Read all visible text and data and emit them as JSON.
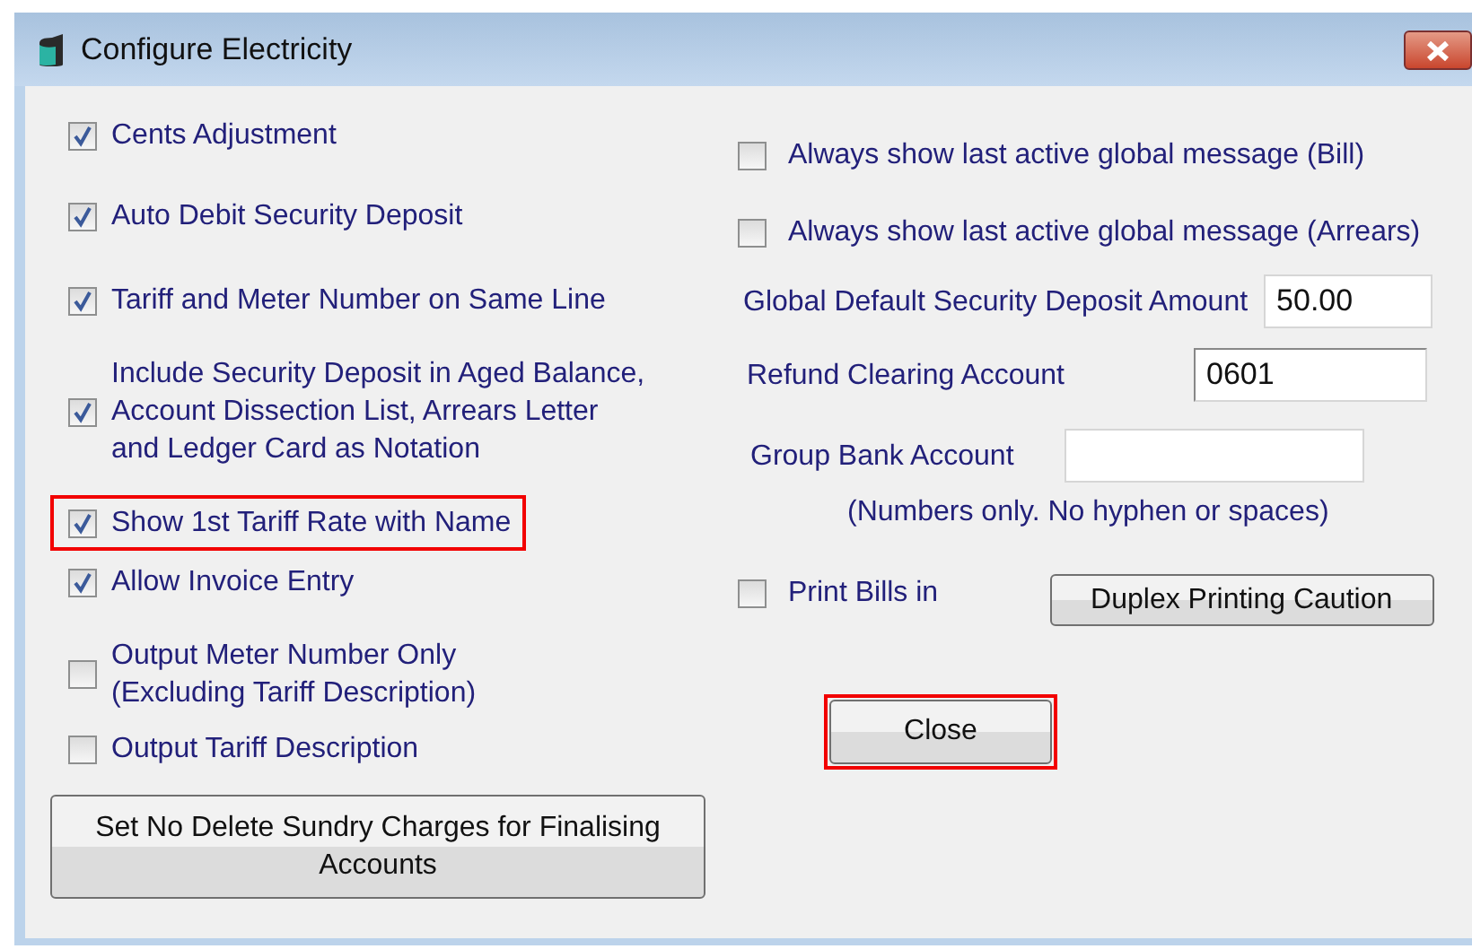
{
  "window": {
    "title": "Configure Electricity"
  },
  "left_options": [
    {
      "label": "Cents Adjustment",
      "checked": true,
      "highlighted": false
    },
    {
      "label": "Auto Debit Security Deposit",
      "checked": true,
      "highlighted": false
    },
    {
      "label": "Tariff and Meter Number on Same Line",
      "checked": true,
      "highlighted": false
    },
    {
      "label": "Include Security Deposit in Aged Balance,\nAccount Dissection List, Arrears Letter\nand Ledger Card as Notation",
      "checked": true,
      "highlighted": false
    },
    {
      "label": "Show 1st Tariff Rate with Name",
      "checked": true,
      "highlighted": true
    },
    {
      "label": "Allow Invoice Entry",
      "checked": true,
      "highlighted": false
    },
    {
      "label": "Output Meter Number Only\n(Excluding Tariff Description)",
      "checked": false,
      "highlighted": false
    },
    {
      "label": "Output Tariff Description",
      "checked": false,
      "highlighted": false
    }
  ],
  "left_button": {
    "label": "Set No Delete Sundry Charges for Finalising Accounts"
  },
  "right_options": [
    {
      "label": "Always show last active global message (Bill)",
      "checked": false
    },
    {
      "label": "Always show last active global message (Arrears)",
      "checked": false
    }
  ],
  "fields": [
    {
      "label": "Global Default Security Deposit Amount",
      "value": "50.00"
    },
    {
      "label": "Refund Clearing Account",
      "value": "0601"
    },
    {
      "label": "Group Bank Account"
    }
  ],
  "note": "(Numbers only. No hyphen or spaces)",
  "print_bills": {
    "label": "Print Bills in",
    "checked": false
  },
  "duplex_button": {
    "label": "Duplex Printing Caution"
  },
  "close_button": {
    "label": "Close",
    "highlighted": true
  }
}
